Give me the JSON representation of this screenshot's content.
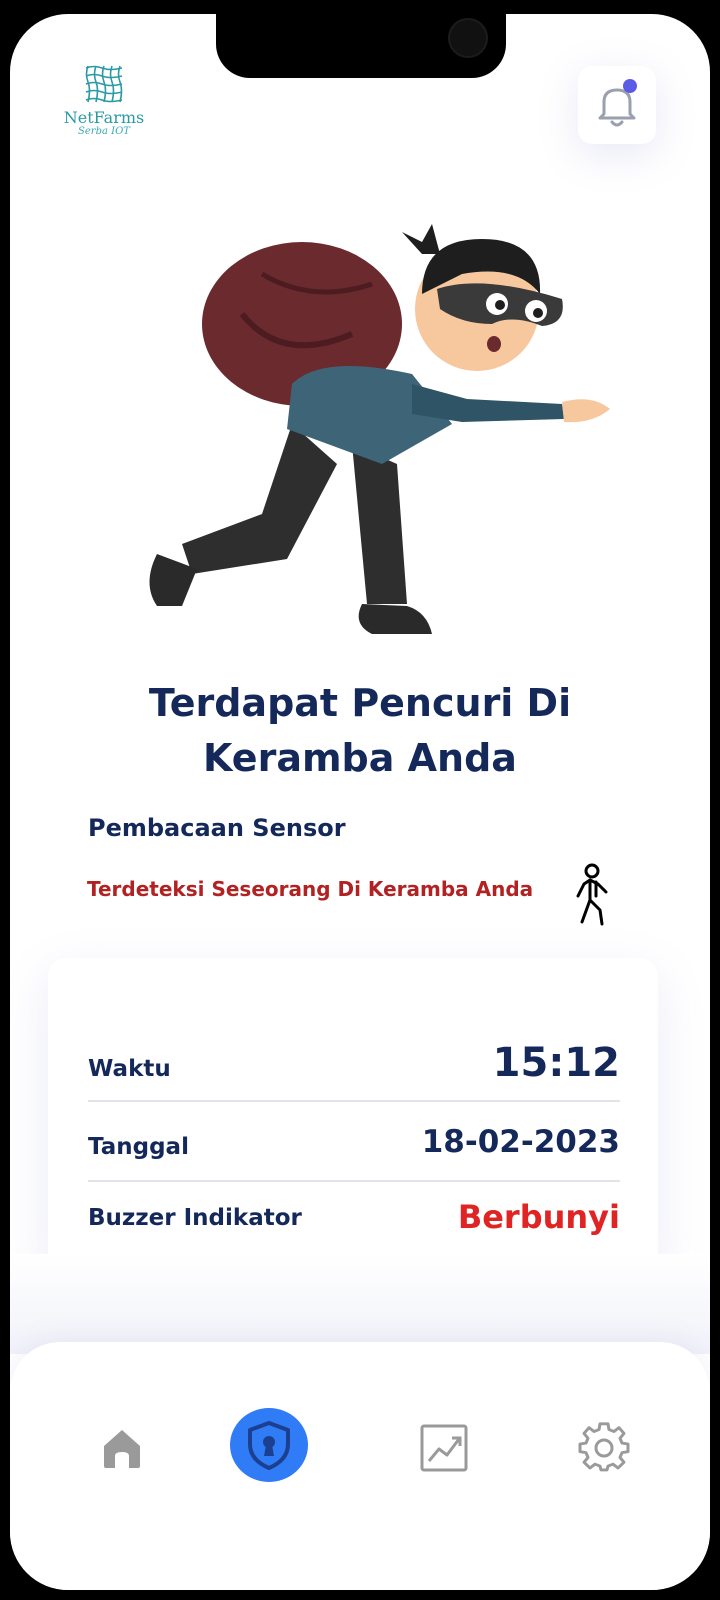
{
  "app": {
    "logo_name": "NetFarms",
    "logo_sub": "Serba IOT"
  },
  "header": {
    "bell_icon": "bell-icon",
    "notification_dot_color": "#5b5ce6"
  },
  "alert": {
    "title_line1": "Terdapat Pencuri Di",
    "title_line2": "Keramba Anda"
  },
  "sensor": {
    "heading": "Pembacaan Sensor",
    "detection": "Terdeteksi Seseorang Di Keramba Anda",
    "icon": "person-walking-icon"
  },
  "details": {
    "time_label": "Waktu",
    "time_value": "15:12",
    "date_label": "Tanggal",
    "date_value": "18-02-2023",
    "buzzer_label": "Buzzer Indikator",
    "buzzer_value": "Berbunyi"
  },
  "nav": {
    "items": [
      "home-icon",
      "shield-lock-icon",
      "chart-icon",
      "gear-icon"
    ],
    "active_color": "#2f7cf6"
  },
  "colors": {
    "primary_text": "#14285a",
    "alert": "#b22222",
    "buzzer": "#e02424"
  }
}
